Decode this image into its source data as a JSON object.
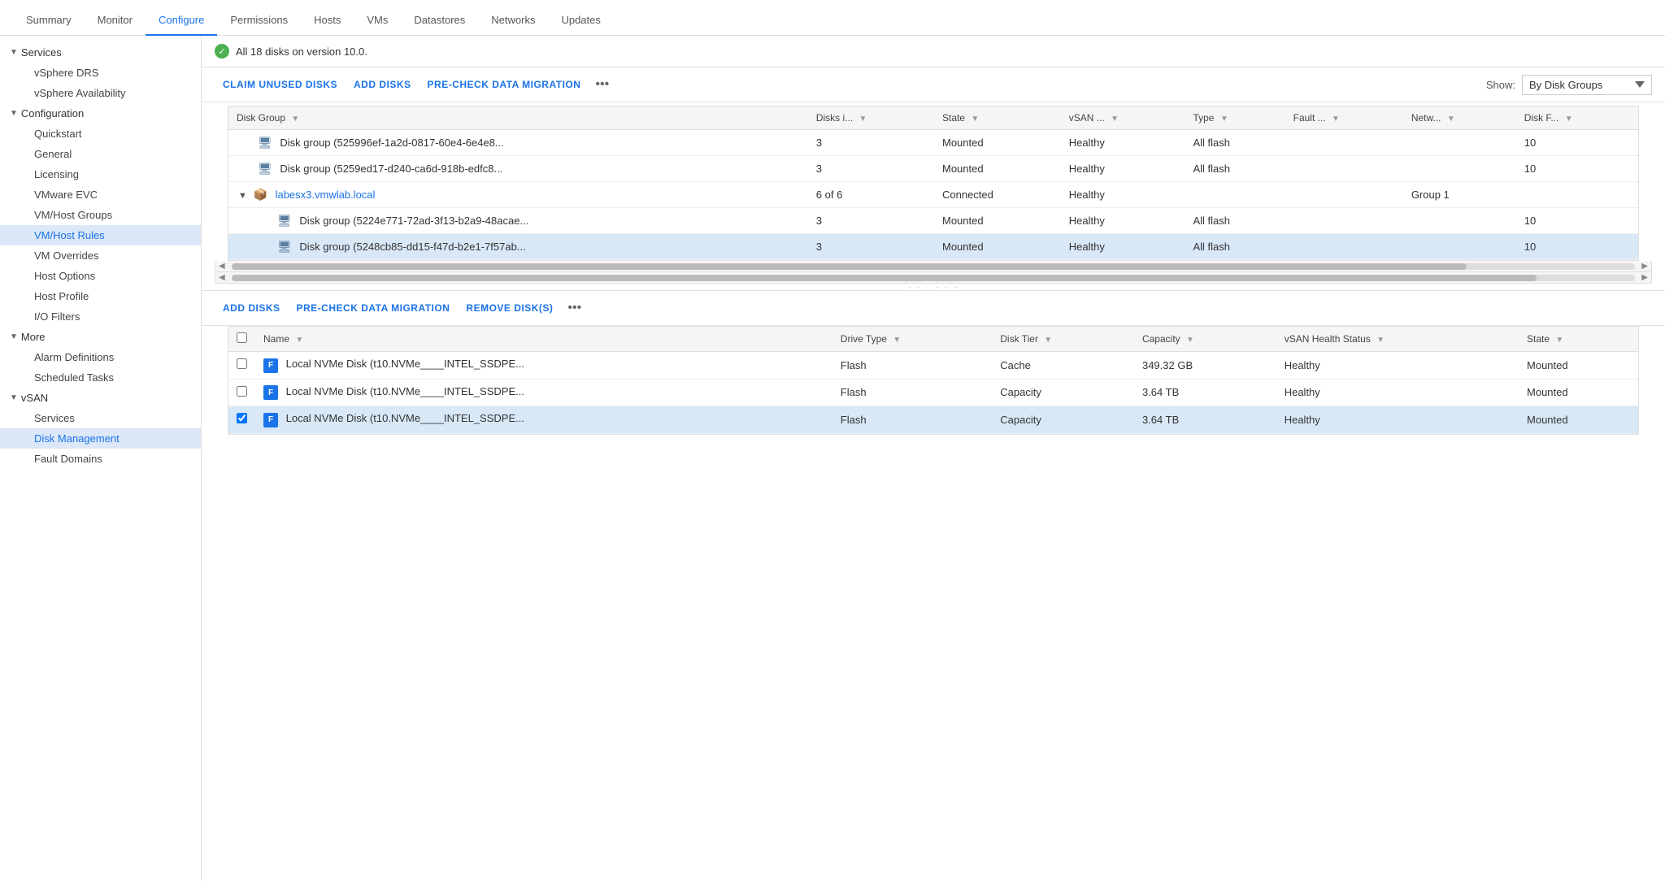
{
  "nav": {
    "tabs": [
      {
        "label": "Summary",
        "active": false
      },
      {
        "label": "Monitor",
        "active": false
      },
      {
        "label": "Configure",
        "active": true
      },
      {
        "label": "Permissions",
        "active": false
      },
      {
        "label": "Hosts",
        "active": false
      },
      {
        "label": "VMs",
        "active": false
      },
      {
        "label": "Datastores",
        "active": false
      },
      {
        "label": "Networks",
        "active": false
      },
      {
        "label": "Updates",
        "active": false
      }
    ]
  },
  "sidebar": {
    "services_group": "Services",
    "vsphere_drs": "vSphere DRS",
    "vsphere_availability": "vSphere Availability",
    "configuration_group": "Configuration",
    "quickstart": "Quickstart",
    "general": "General",
    "licensing": "Licensing",
    "vmware_evc": "VMware EVC",
    "vm_host_groups": "VM/Host Groups",
    "vm_host_rules": "VM/Host Rules",
    "vm_overrides": "VM Overrides",
    "host_options": "Host Options",
    "host_profile": "Host Profile",
    "io_filters": "I/O Filters",
    "more_group": "More",
    "alarm_definitions": "Alarm Definitions",
    "scheduled_tasks": "Scheduled Tasks",
    "vsan_group": "vSAN",
    "vsan_services": "Services",
    "disk_management": "Disk Management",
    "fault_domains": "Fault Domains"
  },
  "status": {
    "message": "All 18 disks on version 10.0."
  },
  "upper_toolbar": {
    "claim_unused": "CLAIM UNUSED DISKS",
    "add_disks": "ADD DISKS",
    "pre_check": "PRE-CHECK DATA MIGRATION",
    "show_label": "Show:",
    "show_value": "By Disk Groups"
  },
  "upper_table": {
    "columns": [
      {
        "label": "Disk Group",
        "key": "disk_group"
      },
      {
        "label": "Disks i...",
        "key": "disks_in"
      },
      {
        "label": "State",
        "key": "state"
      },
      {
        "label": "vSAN ...",
        "key": "vsan"
      },
      {
        "label": "Type",
        "key": "type"
      },
      {
        "label": "Fault ...",
        "key": "fault"
      },
      {
        "label": "Netw...",
        "key": "network"
      },
      {
        "label": "Disk F...",
        "key": "disk_f"
      }
    ],
    "rows": [
      {
        "type": "disk",
        "indent": 1,
        "name": "Disk group (525996ef-1a2d-0817-60e4-6e4e8...",
        "disks_in": "3",
        "state": "Mounted",
        "vsan": "Healthy",
        "disk_type": "All flash",
        "fault": "",
        "network": "",
        "disk_f": "10",
        "selected": false
      },
      {
        "type": "disk",
        "indent": 1,
        "name": "Disk group (5259ed17-d240-ca6d-918b-edfc8...",
        "disks_in": "3",
        "state": "Mounted",
        "vsan": "Healthy",
        "disk_type": "All flash",
        "fault": "",
        "network": "",
        "disk_f": "10",
        "selected": false
      },
      {
        "type": "host",
        "indent": 0,
        "name": "labesx3.vmwlab.local",
        "disks_in": "6 of 6",
        "state": "Connected",
        "vsan": "Healthy",
        "disk_type": "",
        "fault": "",
        "network": "Group 1",
        "disk_f": "",
        "selected": false
      },
      {
        "type": "disk",
        "indent": 2,
        "name": "Disk group (5224e771-72ad-3f13-b2a9-48acae...",
        "disks_in": "3",
        "state": "Mounted",
        "vsan": "Healthy",
        "disk_type": "All flash",
        "fault": "",
        "network": "",
        "disk_f": "10",
        "selected": false
      },
      {
        "type": "disk",
        "indent": 2,
        "name": "Disk group (5248cb85-dd15-f47d-b2e1-7f57ab...",
        "disks_in": "3",
        "state": "Mounted",
        "vsan": "Healthy",
        "disk_type": "All flash",
        "fault": "",
        "network": "",
        "disk_f": "10",
        "selected": true
      }
    ]
  },
  "lower_toolbar": {
    "add_disks": "ADD DISKS",
    "pre_check": "PRE-CHECK DATA MIGRATION",
    "remove_disks": "REMOVE DISK(S)"
  },
  "lower_table": {
    "columns": [
      {
        "label": "Name",
        "key": "name"
      },
      {
        "label": "Drive Type",
        "key": "drive_type"
      },
      {
        "label": "Disk Tier",
        "key": "disk_tier"
      },
      {
        "label": "Capacity",
        "key": "capacity"
      },
      {
        "label": "vSAN Health Status",
        "key": "vsan_health"
      },
      {
        "label": "State",
        "key": "state"
      }
    ],
    "rows": [
      {
        "checked": false,
        "name": "Local NVMe Disk (t10.NVMe____INTEL_SSDPE...",
        "drive_type": "Flash",
        "disk_tier": "Cache",
        "capacity": "349.32 GB",
        "vsan_health": "Healthy",
        "state": "Mounted",
        "selected": false
      },
      {
        "checked": false,
        "name": "Local NVMe Disk (t10.NVMe____INTEL_SSDPE...",
        "drive_type": "Flash",
        "disk_tier": "Capacity",
        "capacity": "3.64 TB",
        "vsan_health": "Healthy",
        "state": "Mounted",
        "selected": false
      },
      {
        "checked": true,
        "name": "Local NVMe Disk (t10.NVMe____INTEL_SSDPE...",
        "drive_type": "Flash",
        "disk_tier": "Capacity",
        "capacity": "3.64 TB",
        "vsan_health": "Healthy",
        "state": "Mounted",
        "selected": true
      }
    ]
  }
}
